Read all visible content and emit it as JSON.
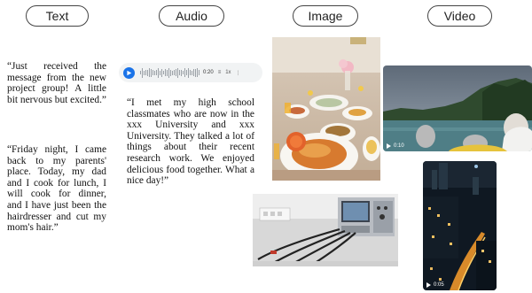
{
  "headers": {
    "text": "Text",
    "audio": "Audio",
    "image": "Image",
    "video": "Video"
  },
  "text_column": {
    "quote1": "“Just received the message from the new project group! A little bit nervous but excited.”",
    "quote2": "“Friday night, I came back to my parents' place. Today, my dad and I cook for lunch, I will cook for dinner, and I have just been the hairdresser and cut my mom's hair.”"
  },
  "audio_column": {
    "player_time": "0:20",
    "player_speed": "1x",
    "transcript": "“I met my high school classmates who are now in the xxx University and xxx University. They talked a lot of things about their recent research work. We enjoyed delicious food together. What a nice day!”"
  },
  "video_column": {
    "video1_time": "0:10",
    "video2_time": "0:05"
  },
  "icons": {
    "play": "play-icon",
    "caption": "caption-icon",
    "more": "more-vertical-icon",
    "video_play": "video-play-icon"
  },
  "colors": {
    "audio_play_button": "#1a73e8",
    "pill_border": "#444444"
  }
}
